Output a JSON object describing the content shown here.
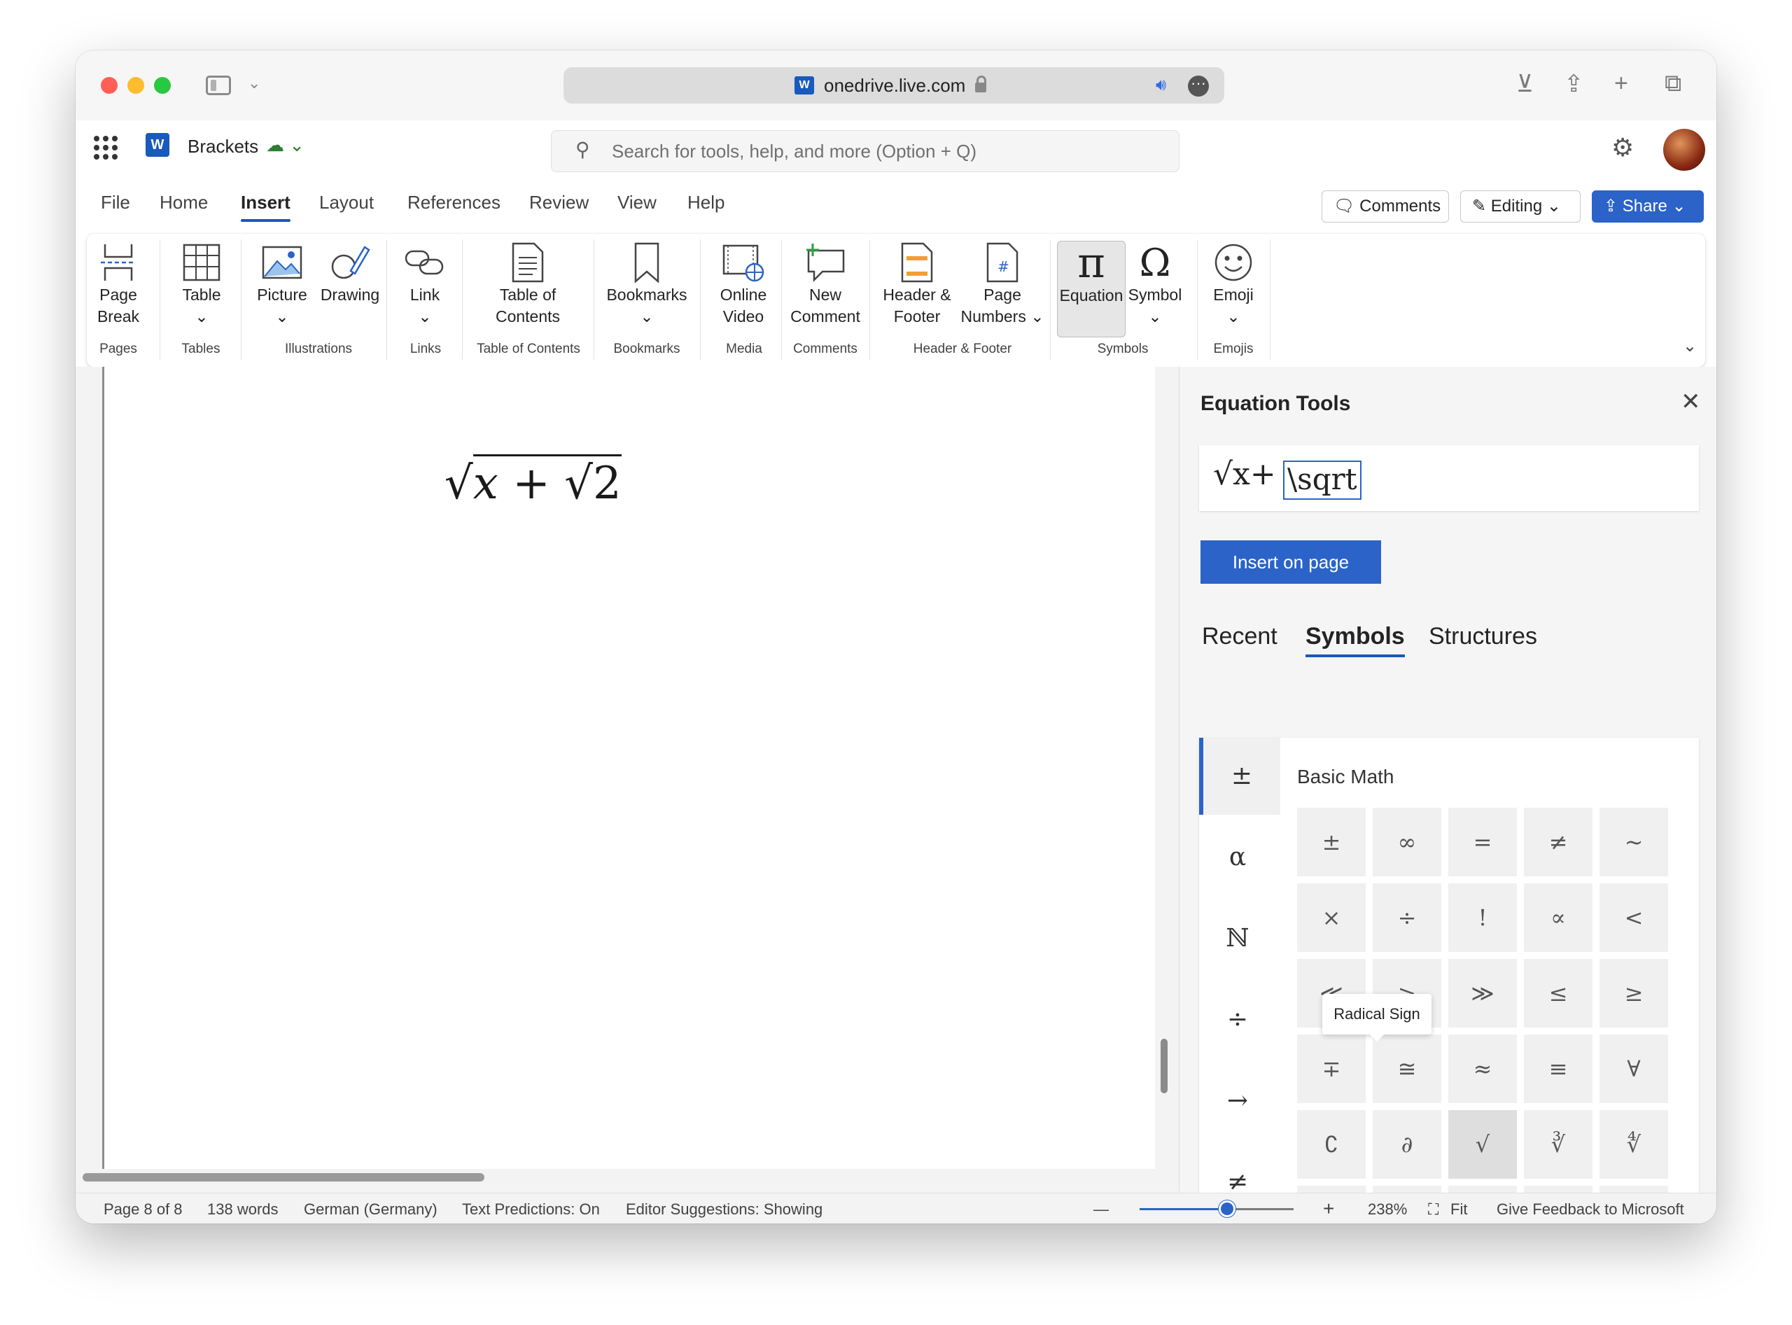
{
  "browser": {
    "url_host": "onedrive.live.com",
    "word_badge": "W"
  },
  "app": {
    "doc_name": "Brackets",
    "word_logo": "W",
    "search_placeholder": "Search for tools, help, and more (Option + Q)"
  },
  "tabs": [
    "File",
    "Home",
    "Insert",
    "Layout",
    "References",
    "Review",
    "View",
    "Help"
  ],
  "active_tab": "Insert",
  "header_buttons": {
    "comments": "Comments",
    "editing": "Editing",
    "share": "Share"
  },
  "ribbon": {
    "buttons": [
      {
        "l1": "Page",
        "l2": "Break",
        "icon": "page-break-icon"
      },
      {
        "l1": "Table",
        "l2": "⌄",
        "icon": "table-icon"
      },
      {
        "l1": "Picture",
        "l2": "⌄",
        "icon": "picture-icon"
      },
      {
        "l1": "Drawing",
        "l2": "",
        "icon": "drawing-icon"
      },
      {
        "l1": "Link",
        "l2": "⌄",
        "icon": "link-icon"
      },
      {
        "l1": "Table of",
        "l2": "Contents",
        "icon": "toc-icon"
      },
      {
        "l1": "Bookmarks",
        "l2": "⌄",
        "icon": "bookmark-icon"
      },
      {
        "l1": "Online",
        "l2": "Video",
        "icon": "video-icon"
      },
      {
        "l1": "New",
        "l2": "Comment",
        "icon": "comment-icon"
      },
      {
        "l1": "Header &",
        "l2": "Footer",
        "icon": "header-icon"
      },
      {
        "l1": "Page",
        "l2": "Numbers ⌄",
        "icon": "page-numbers-icon"
      },
      {
        "l1": "Equation",
        "l2": "",
        "icon": "pi-icon"
      },
      {
        "l1": "Symbol",
        "l2": "⌄",
        "icon": "omega-icon"
      },
      {
        "l1": "Emoji",
        "l2": "⌄",
        "icon": "emoji-icon"
      }
    ],
    "groups": [
      "Pages",
      "Tables",
      "Illustrations",
      "Links",
      "Table of Contents",
      "Bookmarks",
      "Media",
      "Comments",
      "Header & Footer",
      "Symbols",
      "Emojis"
    ],
    "page_numbers_glyph": "#",
    "pi_glyph": "π",
    "omega_glyph": "Ω"
  },
  "document": {
    "equation": {
      "root": "√",
      "x": "x",
      "plus": "+",
      "inner_root": "√",
      "two": "2"
    }
  },
  "pane": {
    "title": "Equation Tools",
    "input_prefix": "√x+",
    "input_command": "\\sqrt",
    "insert_button": "Insert on page",
    "tabs": [
      "Recent",
      "Symbols",
      "Structures"
    ],
    "active_tab": "Symbols",
    "categories": [
      "±",
      "α",
      "ℕ",
      "÷",
      "→",
      "≠"
    ],
    "section_title": "Basic Math",
    "symbols": [
      "±",
      "∞",
      "=",
      "≠",
      "~",
      "×",
      "÷",
      "!",
      "∝",
      "<",
      "≪",
      ">",
      "≫",
      "≤",
      "≥",
      "∓",
      "≅",
      "≈",
      "≡",
      "∀",
      "∁",
      "∂",
      "√",
      "∛",
      "∜",
      "∪",
      "∩",
      "∅",
      "%",
      "°"
    ],
    "highlighted_symbol": "√",
    "tooltip": "Radical Sign"
  },
  "status": {
    "page": "Page 8 of 8",
    "words": "138 words",
    "language": "German (Germany)",
    "predictions": "Text Predictions: On",
    "editor": "Editor Suggestions: Showing",
    "zoom_out": "—",
    "zoom_in": "+",
    "zoom": "238%",
    "fit": "Fit",
    "feedback": "Give Feedback to Microsoft",
    "zoom_level": 0.57
  }
}
